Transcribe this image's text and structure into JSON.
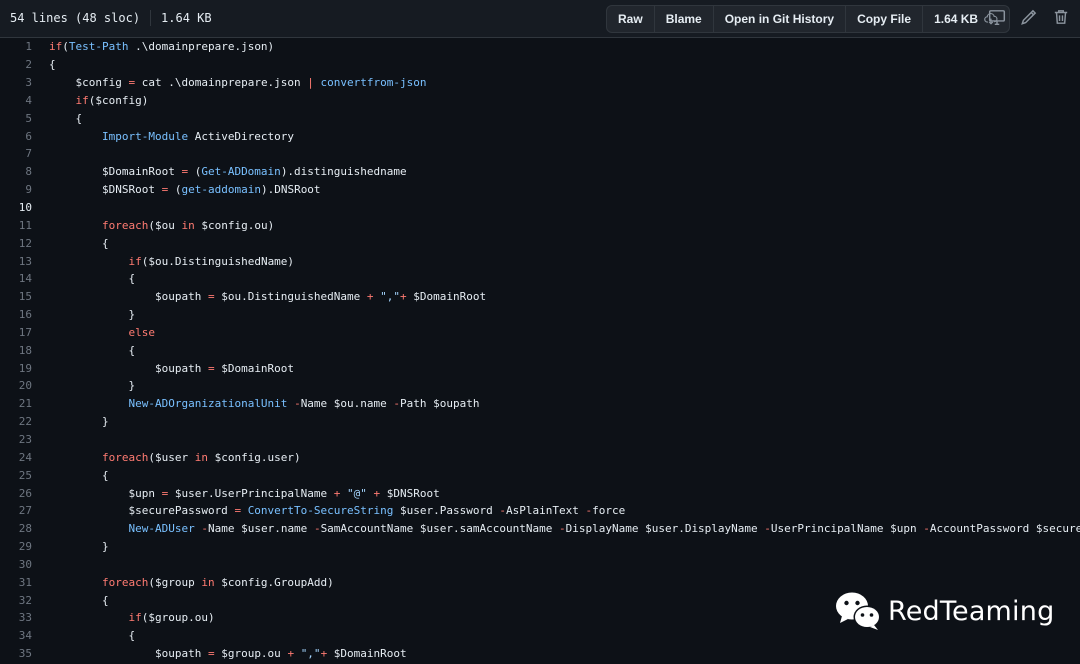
{
  "file_info": {
    "lines_text": "54 lines (48 sloc)",
    "size_text": "1.64 KB"
  },
  "toolbar": {
    "raw_label": "Raw",
    "blame_label": "Blame",
    "git_history_label": "Open in Git History",
    "copy_label": "Copy File",
    "size_label": "1.64 KB",
    "download_icon": "cloud-download-icon",
    "icons": [
      "monitor-icon",
      "pencil-icon",
      "trash-icon"
    ]
  },
  "highlight_line": 10,
  "code_lines": [
    [
      [
        "kw",
        "if"
      ],
      [
        "t",
        "("
      ],
      [
        "fn",
        "Test-Path"
      ],
      [
        "t",
        " .\\domainprepare.json)"
      ]
    ],
    [
      [
        "t",
        "{"
      ]
    ],
    [
      [
        "t",
        "    $config "
      ],
      [
        "kw",
        "="
      ],
      [
        "t",
        " cat .\\domainprepare.json "
      ],
      [
        "kw",
        "|"
      ],
      [
        "t",
        " "
      ],
      [
        "fn",
        "convertfrom-json"
      ]
    ],
    [
      [
        "t",
        "    "
      ],
      [
        "kw",
        "if"
      ],
      [
        "t",
        "($config)"
      ]
    ],
    [
      [
        "t",
        "    {"
      ]
    ],
    [
      [
        "t",
        "        "
      ],
      [
        "fn",
        "Import-Module"
      ],
      [
        "t",
        " ActiveDirectory"
      ]
    ],
    [],
    [
      [
        "t",
        "        $DomainRoot "
      ],
      [
        "kw",
        "="
      ],
      [
        "t",
        " ("
      ],
      [
        "fn",
        "Get-ADDomain"
      ],
      [
        "t",
        ").distinguishedname"
      ]
    ],
    [
      [
        "t",
        "        $DNSRoot "
      ],
      [
        "kw",
        "="
      ],
      [
        "t",
        " ("
      ],
      [
        "fn",
        "get-addomain"
      ],
      [
        "t",
        ").DNSRoot"
      ]
    ],
    [],
    [
      [
        "t",
        "        "
      ],
      [
        "kw",
        "foreach"
      ],
      [
        "t",
        "($ou "
      ],
      [
        "kw",
        "in"
      ],
      [
        "t",
        " $config.ou)"
      ]
    ],
    [
      [
        "t",
        "        {"
      ]
    ],
    [
      [
        "t",
        "            "
      ],
      [
        "kw",
        "if"
      ],
      [
        "t",
        "($ou.DistinguishedName)"
      ]
    ],
    [
      [
        "t",
        "            {"
      ]
    ],
    [
      [
        "t",
        "                $oupath "
      ],
      [
        "kw",
        "="
      ],
      [
        "t",
        " $ou.DistinguishedName "
      ],
      [
        "kw",
        "+"
      ],
      [
        "t",
        " "
      ],
      [
        "st",
        "\",\""
      ],
      [
        "kw",
        "+"
      ],
      [
        "t",
        " $DomainRoot"
      ]
    ],
    [
      [
        "t",
        "            }"
      ]
    ],
    [
      [
        "t",
        "            "
      ],
      [
        "kw",
        "else"
      ]
    ],
    [
      [
        "t",
        "            {"
      ]
    ],
    [
      [
        "t",
        "                $oupath "
      ],
      [
        "kw",
        "="
      ],
      [
        "t",
        " $DomainRoot"
      ]
    ],
    [
      [
        "t",
        "            }"
      ]
    ],
    [
      [
        "t",
        "            "
      ],
      [
        "fn",
        "New-ADOrganizationalUnit"
      ],
      [
        "t",
        " "
      ],
      [
        "kw",
        "-"
      ],
      [
        "t",
        "Name $ou.name "
      ],
      [
        "kw",
        "-"
      ],
      [
        "t",
        "Path $oupath"
      ]
    ],
    [
      [
        "t",
        "        }"
      ]
    ],
    [],
    [
      [
        "t",
        "        "
      ],
      [
        "kw",
        "foreach"
      ],
      [
        "t",
        "($user "
      ],
      [
        "kw",
        "in"
      ],
      [
        "t",
        " $config.user)"
      ]
    ],
    [
      [
        "t",
        "        {"
      ]
    ],
    [
      [
        "t",
        "            $upn "
      ],
      [
        "kw",
        "="
      ],
      [
        "t",
        " $user.UserPrincipalName "
      ],
      [
        "kw",
        "+"
      ],
      [
        "t",
        " "
      ],
      [
        "st",
        "\"@\""
      ],
      [
        "t",
        " "
      ],
      [
        "kw",
        "+"
      ],
      [
        "t",
        " $DNSRoot"
      ]
    ],
    [
      [
        "t",
        "            $securePassword "
      ],
      [
        "kw",
        "="
      ],
      [
        "t",
        " "
      ],
      [
        "fn",
        "ConvertTo-SecureString"
      ],
      [
        "t",
        " $user.Password "
      ],
      [
        "kw",
        "-"
      ],
      [
        "t",
        "AsPlainText "
      ],
      [
        "kw",
        "-"
      ],
      [
        "t",
        "force"
      ]
    ],
    [
      [
        "t",
        "            "
      ],
      [
        "fn",
        "New-ADUser"
      ],
      [
        "t",
        " "
      ],
      [
        "kw",
        "-"
      ],
      [
        "t",
        "Name $user.name "
      ],
      [
        "kw",
        "-"
      ],
      [
        "t",
        "SamAccountName $user.samAccountName "
      ],
      [
        "kw",
        "-"
      ],
      [
        "t",
        "DisplayName $user.DisplayName "
      ],
      [
        "kw",
        "-"
      ],
      [
        "t",
        "UserPrincipalName $upn "
      ],
      [
        "kw",
        "-"
      ],
      [
        "t",
        "AccountPassword $securePass"
      ]
    ],
    [
      [
        "t",
        "        }"
      ]
    ],
    [],
    [
      [
        "t",
        "        "
      ],
      [
        "kw",
        "foreach"
      ],
      [
        "t",
        "($group "
      ],
      [
        "kw",
        "in"
      ],
      [
        "t",
        " $config.GroupAdd)"
      ]
    ],
    [
      [
        "t",
        "        {"
      ]
    ],
    [
      [
        "t",
        "            "
      ],
      [
        "kw",
        "if"
      ],
      [
        "t",
        "($group.ou)"
      ]
    ],
    [
      [
        "t",
        "            {"
      ]
    ],
    [
      [
        "t",
        "                $oupath "
      ],
      [
        "kw",
        "="
      ],
      [
        "t",
        " $group.ou "
      ],
      [
        "kw",
        "+"
      ],
      [
        "t",
        " "
      ],
      [
        "st",
        "\",\""
      ],
      [
        "kw",
        "+"
      ],
      [
        "t",
        " $DomainRoot"
      ]
    ]
  ],
  "watermark": {
    "text": "RedTeaming",
    "icon": "wechat-icon"
  }
}
